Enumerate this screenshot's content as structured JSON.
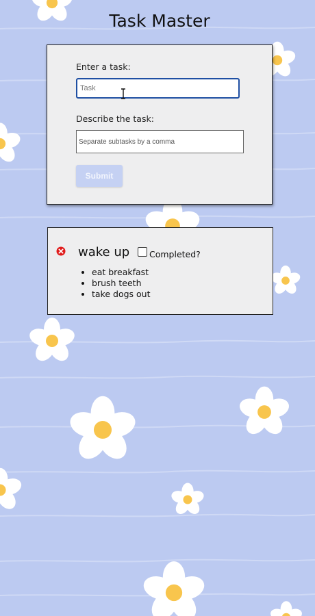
{
  "page": {
    "title": "Task Master",
    "background_color": "#bccaf1"
  },
  "form": {
    "task_label": "Enter a task:",
    "task_placeholder": "Task",
    "task_value": "",
    "desc_label": "Describe the task:",
    "desc_placeholder": "Separate subtasks by a comma",
    "desc_value": "",
    "submit_label": "Submit",
    "accent_color": "#1f4fa3"
  },
  "tasks": [
    {
      "name": "wake up",
      "completed": false,
      "completed_label": "Completed?",
      "subtasks": [
        "eat breakfast",
        "brush teeth",
        "take dogs out"
      ],
      "delete_icon": "close-circle-icon",
      "delete_color": "#e01b1b"
    }
  ]
}
